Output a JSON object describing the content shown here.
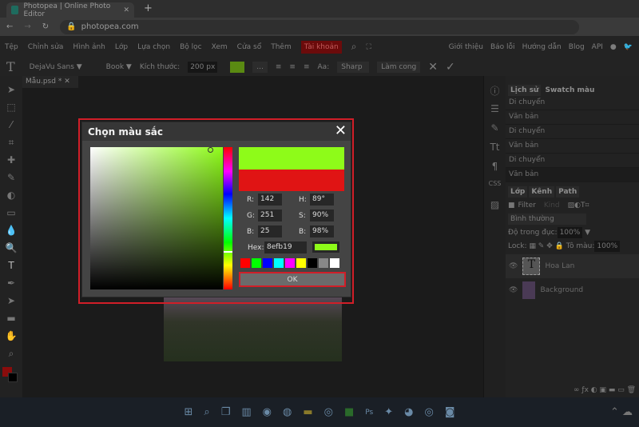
{
  "browser": {
    "tab_title": "Photopea | Online Photo Editor",
    "url": "photopea.com"
  },
  "menu": {
    "items": [
      "Tệp",
      "Chỉnh sửa",
      "Hình ảnh",
      "Lớp",
      "Lựa chọn",
      "Bộ lọc",
      "Xem",
      "Cửa sổ",
      "Thêm"
    ],
    "account": "Tài khoản",
    "right": [
      "Giới thiệu",
      "Báo lỗi",
      "Hướng dẫn",
      "Blog",
      "API"
    ]
  },
  "options": {
    "font": "DejaVu Sans ▼",
    "weight": "Book ▼",
    "size_label": "Kích thước:",
    "size": "200 px",
    "aa_label": "Aa:",
    "aa": "Sharp",
    "warp": "Làm cong",
    "color": "#5a8a12"
  },
  "document": {
    "tab": "Mẫu.psd *"
  },
  "history": {
    "tabs": [
      "Lịch sử",
      "Swatch màu"
    ],
    "items": [
      "Di chuyển",
      "Văn bản",
      "Di chuyển",
      "Văn bản",
      "Di chuyển",
      "Văn bản"
    ]
  },
  "layers": {
    "tabs": [
      "Lớp",
      "Kênh",
      "Path"
    ],
    "filter": "Filter",
    "kind": "Kind",
    "blend": "Bình thường",
    "opacity_label": "Độ trong đục:",
    "opacity": "100%",
    "lock_label": "Lock:",
    "fill_label": "Tô màu:",
    "fill": "100%",
    "items": [
      {
        "name": "Hoa Lan",
        "thumb": "T"
      },
      {
        "name": "Background"
      }
    ]
  },
  "dialog": {
    "title": "Chọn màu sắc",
    "r_label": "R:",
    "r": "142",
    "g_label": "G:",
    "g": "251",
    "b_label": "B:",
    "b": "25",
    "h_label": "H:",
    "h": "89°",
    "s_label": "S:",
    "s": "90%",
    "v_label": "B:",
    "v": "98%",
    "hex_label": "Hex:",
    "hex": "8efb19",
    "new_color": "#8efb19",
    "old_color": "#e01414",
    "swatches": [
      "#ff0000",
      "#00ff00",
      "#0000ff",
      "#00ffff",
      "#ff00ff",
      "#ffff00",
      "#000000",
      "#888888",
      "#ffffff"
    ],
    "ok": "OK"
  }
}
